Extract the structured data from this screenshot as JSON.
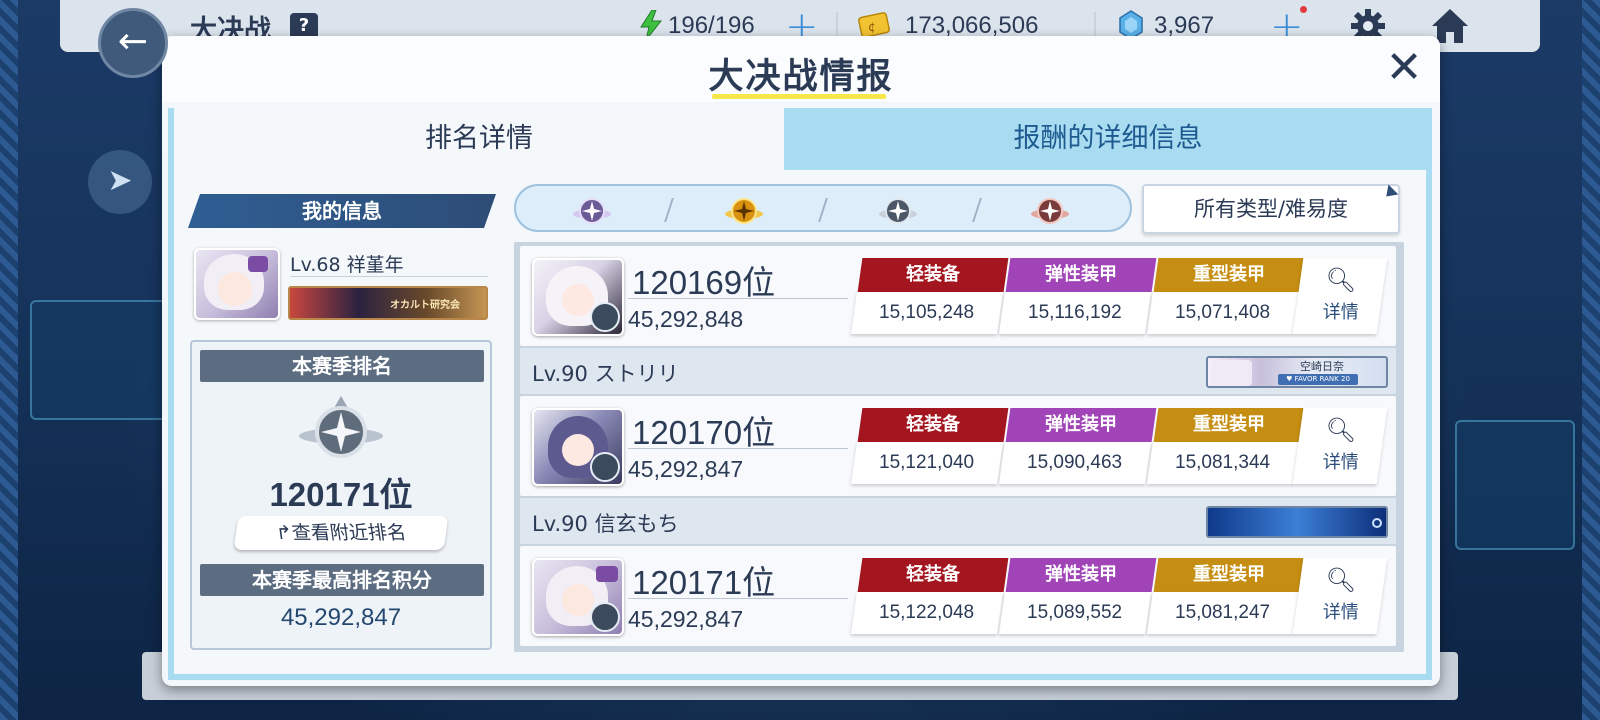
{
  "hud": {
    "title": "大决战",
    "help": "?",
    "ap": "196/196",
    "credits": "173,066,506",
    "gems": "3,967"
  },
  "dialog": {
    "title": "大决战情报",
    "tabs": [
      "排名详情",
      "报酬的详细信息"
    ],
    "active_tab": 0
  },
  "my_info": {
    "header": "我的信息",
    "level_name": "Lv.68 祥堇年",
    "banner_text": "オカルト研究会",
    "season_label": "本赛季排名",
    "season_rank": "120171位",
    "nearby_button": "查看附近排名",
    "best_label": "本赛季最高排名积分",
    "best_score": "45,292,847"
  },
  "filter": {
    "type_dropdown": "所有类型/难易度",
    "emblems": [
      "platinum-purple",
      "gold",
      "silver",
      "bronze"
    ]
  },
  "armor_labels": {
    "light": "轻装备",
    "elastic": "弹性装甲",
    "heavy": "重型装甲"
  },
  "detail_label": "详情",
  "rankings": [
    {
      "rank": "120169位",
      "score": "45,292,848",
      "light": "15,105,248",
      "elastic": "15,116,192",
      "heavy": "15,071,408",
      "name": "Lv.90  ストリリ",
      "banner_name": "空崎日奈",
      "banner_sub": "♥ FAVOR RANK 20"
    },
    {
      "rank": "120170位",
      "score": "45,292,847",
      "light": "15,121,040",
      "elastic": "15,090,463",
      "heavy": "15,081,344",
      "name": "Lv.90  信玄もち"
    },
    {
      "rank": "120171位",
      "score": "45,292,847",
      "light": "15,122,048",
      "elastic": "15,089,552",
      "heavy": "15,081,247"
    }
  ],
  "colors": {
    "light_tag": "#a3161f",
    "elastic_tag": "#a044b8",
    "heavy_tag": "#c58d11",
    "title_underline": "#f6e84a",
    "tab_inactive": "#a9dcf0"
  }
}
